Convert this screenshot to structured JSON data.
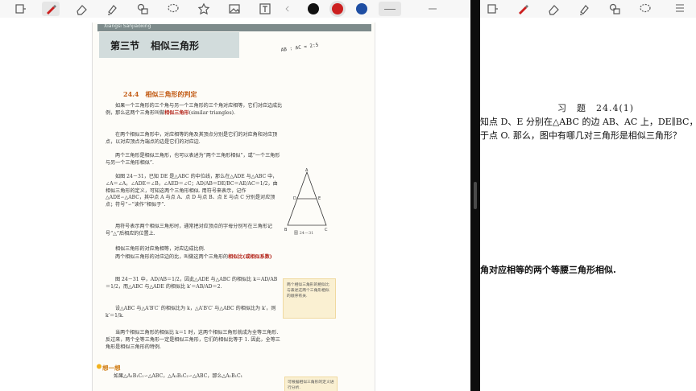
{
  "toolbar": {
    "icons": [
      "rotate-icon",
      "pen-icon",
      "eraser-icon",
      "highlighter-icon",
      "shapes-icon",
      "lasso-icon",
      "sticker-icon",
      "image-icon",
      "text-box-icon",
      "more-icon"
    ],
    "colors": [
      "#111111",
      "#cc1f1f",
      "#1f4ea3"
    ],
    "selected_color": "#cc1f1f"
  },
  "book": {
    "header_pinyin": "Xiangsi Sanjiaoxing",
    "section_num": "第三节",
    "section_title": "相似三角形",
    "subsection": "24.4　相似三角形的判定",
    "para1": "如果一个三角形的三个角与另一个三角形的三个角对应相等，它们对应边成比例，那么这两个三角形叫做",
    "para1_em": "相似三角形",
    "para1_tail": "(similar triangles).",
    "para2": "在两个相似三角形中，对应相等的角及其顶点分别是它们的对应角和对应顶点，以对应顶点为端点的边是它们的对应边.",
    "para3": "两个三角形是相似三角形，也可以表述为“两个三角形相似”，或“一个三角形与另一个三角形相似”.",
    "para4": "如图 24－31，已知 DE 是△ABC 的中位线，那么在△ADE 与△ABC 中，∠A＝∠A，∠ADE＝∠B，∠AED＝∠C；AD/AB＝DE/BC＝AE/AC＝1/2，由相似三角形的定义，可知这两个三角形相似. 用符号来表示，记作△ADE∽△ABC，其中点 A 与点 A、点 D 与点 B、点 E 与点 C 分别是对应顶点；符号“∽”读作“相似于”.",
    "para5": "用符号表示两个相似三角形时，通常把对应顶点的字母分别写在三角形记号“△”后相应的位置上.",
    "para6": "相似三角形的对应角相等，对应边成比例.",
    "para7": "两个相似三角形的对应边的比，叫做这两个三角形的",
    "para7_em": "相似比",
    "para7_em2": "(或相似系数)",
    "para8": "图 24－31 中，AD/AB＝1/2，因此△ADE 与△ABC 的相似比 k＝AD/AB＝1/2，而△ABC 与△ADE 的相似比 k′＝AB/AD＝2.",
    "para9": "设△ABC 与△A′B′C′ 的相似比为 k，△A′B′C′ 与△ABC 的相似比为 k′，则 k′＝1/k.",
    "para10": "当两个相似三角形的相似比 k＝1 时，这两个相似三角形就成为全等三角形. 反过来，两个全等三角形一定是相似三角形，它们的相似比等于 1. 因此，全等三角形是相似三角形的特例.",
    "think_label": "想一想",
    "think_text": "如果△A₁B₁C₁∽△ABC，△A₂B₂C₂∽△ABC，那么△A₁B₁C₁",
    "fig_caption": "图 24－31",
    "fig_A": "A",
    "fig_D": "D",
    "fig_E": "E",
    "fig_B": "B",
    "fig_C": "C",
    "side_note": "两个相似三角形的相似比与表述这两个三角形相似的顺序有关.",
    "side_note2": "可根据相似三角形的定义进行分析.",
    "hand_note": "AB : AC = 2:5"
  },
  "exercise": {
    "title": "习　题　24.4(1)",
    "line1": "知点 D、E 分别在△ABC 的边 AB、AC 上，DE∥BC，",
    "line2": "于点 O. 那么，图中有哪几对三角形是相似三角形？",
    "line3": "角对应相等的两个等腰三角形相似."
  }
}
